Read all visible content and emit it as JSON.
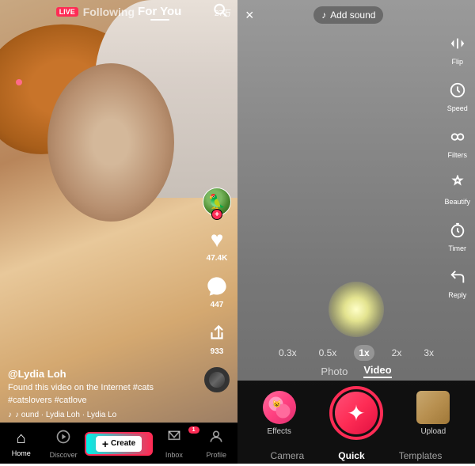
{
  "left": {
    "nav": {
      "live_badge": "LIVE",
      "following": "Following",
      "for_you": "For You",
      "search_icon": "search"
    },
    "video": {
      "view_count": "27万",
      "username": "@Lydia Loh",
      "description": "Found this video on the Internet #cats #catslovers #catlove",
      "sound": "♪ ound · Lydia Loh · Lydia Lo",
      "like_count": "47.4K",
      "comment_count": "447",
      "share_count": "933"
    },
    "bottom_nav": {
      "home": "Home",
      "discover": "Discover",
      "create": "Create",
      "inbox": "Inbox",
      "inbox_badge": "1",
      "profile": "Profile"
    }
  },
  "right": {
    "header": {
      "close_label": "×",
      "add_sound_label": "Add sound",
      "music_icon": "♪"
    },
    "tools": [
      {
        "icon": "flip",
        "label": "Flip"
      },
      {
        "icon": "1x",
        "label": "Speed"
      },
      {
        "icon": "filters",
        "label": "Filters"
      },
      {
        "icon": "beauty",
        "label": "Beautify"
      },
      {
        "icon": "timer",
        "label": "Timer"
      },
      {
        "icon": "reply",
        "label": "Reply"
      }
    ],
    "speed_options": [
      {
        "value": "0.3x",
        "active": false
      },
      {
        "value": "0.5x",
        "active": false
      },
      {
        "value": "1x",
        "active": true
      },
      {
        "value": "2x",
        "active": false
      },
      {
        "value": "3x",
        "active": false
      }
    ],
    "mode_tabs": [
      {
        "label": "Photo",
        "active": false
      },
      {
        "label": "Video",
        "active": true
      }
    ],
    "controls": {
      "effects_label": "Effects",
      "upload_label": "Upload",
      "sparkle_icon": "✦"
    },
    "camera_nav": [
      {
        "label": "Camera",
        "active": false
      },
      {
        "label": "Quick",
        "active": true
      },
      {
        "label": "Templates",
        "active": false
      }
    ]
  }
}
